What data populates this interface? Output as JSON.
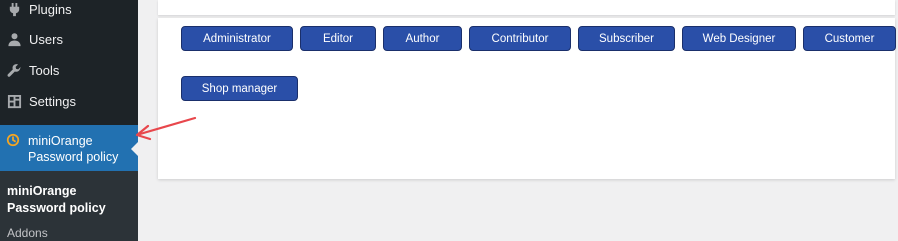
{
  "sidebar": {
    "items": [
      {
        "label": "Plugins",
        "icon": "plugin-icon"
      },
      {
        "label": "Users",
        "icon": "users-icon"
      },
      {
        "label": "Tools",
        "icon": "wrench-icon"
      },
      {
        "label": "Settings",
        "icon": "settings-icon"
      }
    ],
    "active": {
      "line1": "miniOrange",
      "line2": "Password policy",
      "icon": "miniorange-icon"
    },
    "submenu": {
      "title_line1": "miniOrange",
      "title_line2": "Password policy",
      "addons": "Addons"
    }
  },
  "roles": {
    "row1": [
      "Administrator",
      "Editor",
      "Author",
      "Contributor",
      "Subscriber",
      "Web Designer",
      "Customer"
    ],
    "row2": [
      "Shop manager"
    ]
  },
  "colors": {
    "sidebar_bg": "#1d2327",
    "active_bg": "#2271b1",
    "button_bg": "#2a4fa8",
    "arrow": "#e8474c"
  }
}
